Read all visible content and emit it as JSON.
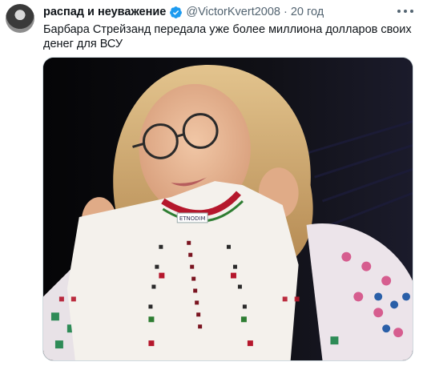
{
  "author": {
    "name": "распад и неуважение",
    "handle": "@VictorKvert2008",
    "separator": "·",
    "time": "20 год"
  },
  "tweet": {
    "text": "Барбара Стрейзанд передала уже более миллиона долларов своих денег для ВСУ"
  },
  "media": {
    "shirt_tag_text": "ETNODIM",
    "colors": {
      "background": "#0d0d0f",
      "hair": "#d7b37c",
      "shirt": "#f4f1ec",
      "embroidery_red": "#b5172c",
      "embroidery_green": "#2e7d32"
    }
  },
  "icons": {
    "verified": "verified-badge-icon",
    "more": "more-options-icon"
  },
  "colors": {
    "verified": "#1d9bf0",
    "secondary_text": "#536471"
  }
}
